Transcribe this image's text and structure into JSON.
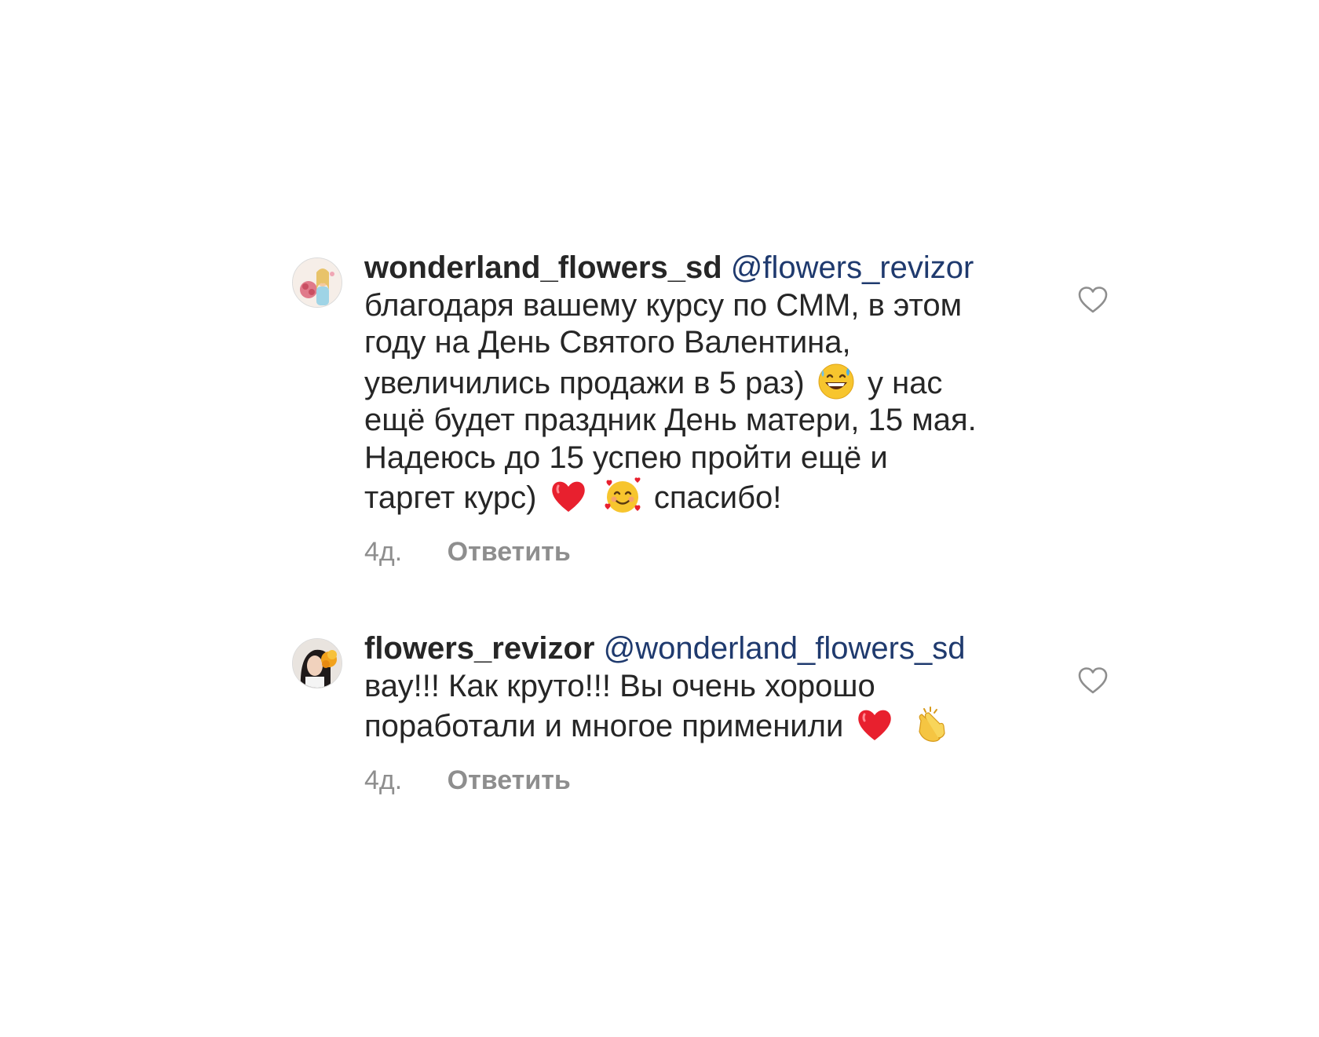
{
  "comments": [
    {
      "username": "wonderland_flowers_sd",
      "mention": "@flowers_revizor",
      "text_lines": [
        "благодаря вашему курсу по СММ, в этом",
        "году на День Святого Валентина,",
        "увеличились продажи в 5 раз)",
        "у нас",
        "ещё будет праздник День матери, 15 мая.",
        "Надеюсь до 15 успею пройти ещё и",
        "таргет курс)",
        "спасибо!"
      ],
      "emojis": [
        "grinning-sweat-emoji",
        "red-heart-emoji",
        "smiling-face-with-hearts-emoji"
      ],
      "time": "4д.",
      "reply_label": "Ответить",
      "like_icon": "heart-outline-icon"
    },
    {
      "username": "flowers_revizor",
      "mention": "@wonderland_flowers_sd",
      "text_lines": [
        "вау!!! Как круто!!! Вы очень хорошо",
        "поработали и многое применили"
      ],
      "emojis": [
        "red-heart-emoji",
        "clapping-hands-emoji"
      ],
      "time": "4д.",
      "reply_label": "Ответить",
      "like_icon": "heart-outline-icon"
    }
  ],
  "colors": {
    "text": "#262626",
    "mention": "#1f3a6e",
    "meta": "#8e8e8e",
    "background": "#ffffff"
  }
}
